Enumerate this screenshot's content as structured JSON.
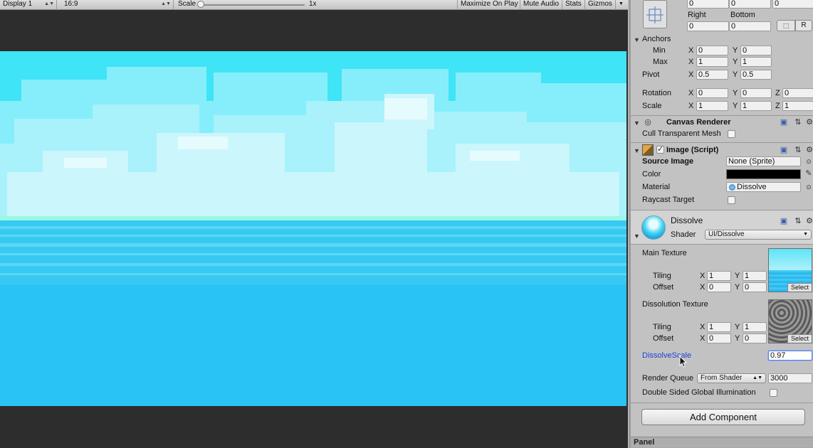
{
  "toolbar": {
    "display": "Display 1",
    "aspect": "16:9",
    "scale_label": "Scale",
    "scale_value": "1x",
    "scale_fraction": 0.0,
    "maximize": "Maximize On Play",
    "mute": "Mute Audio",
    "stats": "Stats",
    "gizmos": "Gizmos"
  },
  "rect": {
    "top_vals": [
      "0",
      "0",
      "0"
    ],
    "right_label": "Right",
    "bottom_label": "Bottom",
    "right": "0",
    "bottom": "0",
    "r_button": "R"
  },
  "anchors": {
    "title": "Anchors",
    "min_label": "Min",
    "min_x": "0",
    "min_y": "0",
    "max_label": "Max",
    "max_x": "1",
    "max_y": "1"
  },
  "pivot": {
    "label": "Pivot",
    "x": "0.5",
    "y": "0.5"
  },
  "rotation": {
    "label": "Rotation",
    "x": "0",
    "y": "0",
    "z": "0"
  },
  "scale": {
    "label": "Scale",
    "x": "1",
    "y": "1",
    "z": "1"
  },
  "axis": {
    "x": "X",
    "y": "Y",
    "z": "Z"
  },
  "canvas_renderer": {
    "title": "Canvas Renderer",
    "cull_label": "Cull Transparent Mesh",
    "cull_checked": false
  },
  "image": {
    "title": "Image (Script)",
    "enabled": true,
    "source_label": "Source Image",
    "source_value": "None (Sprite)",
    "color_label": "Color",
    "color_value": "#000000",
    "material_label": "Material",
    "material_value": "Dissolve",
    "raycast_label": "Raycast Target",
    "raycast_checked": false
  },
  "material": {
    "name": "Dissolve",
    "shader_label": "Shader",
    "shader_value": "UI/Dissolve",
    "main_texture": {
      "label": "Main Texture",
      "tiling_label": "Tiling",
      "tiling_x": "1",
      "tiling_y": "1",
      "offset_label": "Offset",
      "offset_x": "0",
      "offset_y": "0",
      "select": "Select"
    },
    "dissolution_texture": {
      "label": "Dissolution Texture",
      "tiling_label": "Tiling",
      "tiling_x": "1",
      "tiling_y": "1",
      "offset_label": "Offset",
      "offset_x": "0",
      "offset_y": "0",
      "select": "Select"
    },
    "dissolve_scale_label": "DissolveScale",
    "dissolve_scale_value": "0.97",
    "render_queue_label": "Render Queue",
    "render_queue_mode": "From Shader",
    "render_queue_value": "3000",
    "dsgi_label": "Double Sided Global Illumination",
    "dsgi_checked": false
  },
  "add_component": "Add Component",
  "panel_label": "Panel",
  "colors": {
    "sky": "#3fe4f6",
    "sea": "#29c3f5",
    "cloud": "#bff4fb",
    "selected_label": "#1d3fd6",
    "editor_gray": "#c2c2c2"
  }
}
